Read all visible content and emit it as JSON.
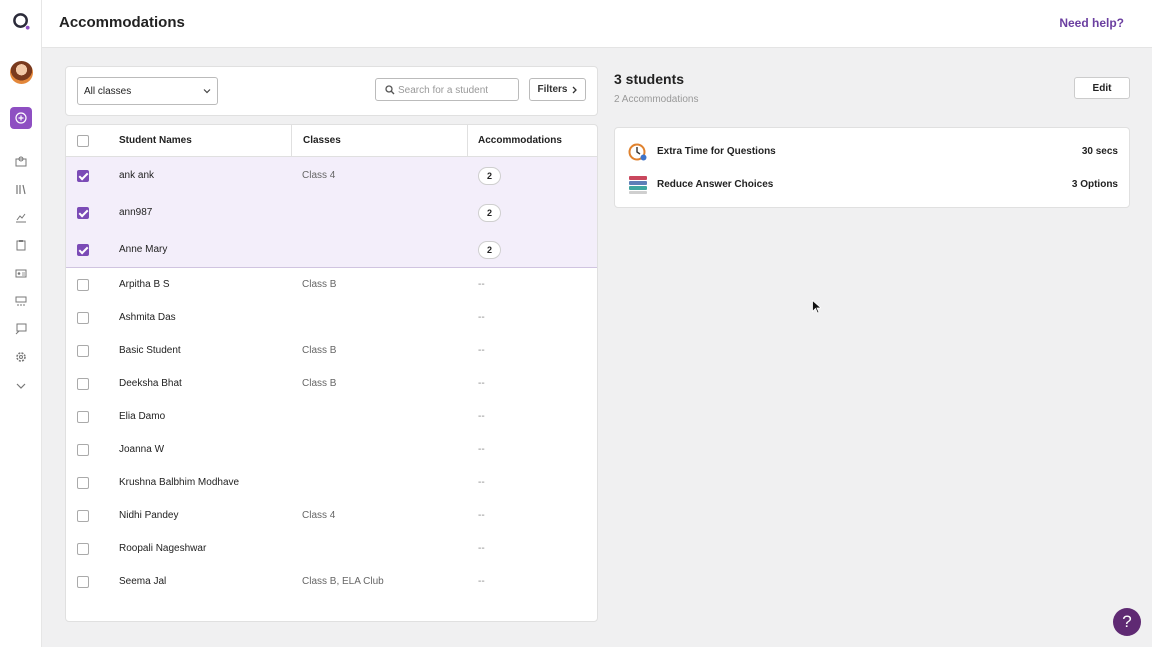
{
  "header": {
    "title": "Accommodations",
    "help_link": "Need help?"
  },
  "sidebar": {
    "icons": [
      "logo-icon",
      "avatar",
      "plus-icon",
      "users-icon",
      "library-icon",
      "reports-icon",
      "clipboard-icon",
      "id-card-icon",
      "classroom-icon",
      "chat-icon",
      "settings-icon",
      "chevron-down-icon"
    ]
  },
  "filters": {
    "class_select": "All classes",
    "search_placeholder": "Search for a student",
    "filters_button": "Filters"
  },
  "table": {
    "columns": [
      "Student Names",
      "Classes",
      "Accommodations"
    ],
    "rows": [
      {
        "name": "ank ank",
        "class": "Class 4",
        "accommodations": "2",
        "selected": true
      },
      {
        "name": "ann987",
        "class": "",
        "accommodations": "2",
        "selected": true
      },
      {
        "name": "Anne Mary",
        "class": "",
        "accommodations": "2",
        "selected": true
      },
      {
        "name": "Arpitha B S",
        "class": "Class B",
        "accommodations": "--",
        "selected": false
      },
      {
        "name": "Ashmita Das",
        "class": "",
        "accommodations": "--",
        "selected": false
      },
      {
        "name": "Basic Student",
        "class": "Class B",
        "accommodations": "--",
        "selected": false
      },
      {
        "name": "Deeksha Bhat",
        "class": "Class B",
        "accommodations": "--",
        "selected": false
      },
      {
        "name": "Elia Damo",
        "class": "",
        "accommodations": "--",
        "selected": false
      },
      {
        "name": "Joanna W",
        "class": "",
        "accommodations": "--",
        "selected": false
      },
      {
        "name": "Krushna Balbhim Modhave",
        "class": "",
        "accommodations": "--",
        "selected": false
      },
      {
        "name": "Nidhi Pandey",
        "class": "Class 4",
        "accommodations": "--",
        "selected": false
      },
      {
        "name": "Roopali Nageshwar",
        "class": "",
        "accommodations": "--",
        "selected": false
      },
      {
        "name": "Seema Jal",
        "class": "Class B, ELA Club",
        "accommodations": "--",
        "selected": false
      }
    ]
  },
  "summary": {
    "title": "3 students",
    "subtitle": "2 Accommodations",
    "edit_button": "Edit",
    "items": [
      {
        "icon": "timer-icon",
        "label": "Extra Time for Questions",
        "value": "30 secs"
      },
      {
        "icon": "stack-icon",
        "label": "Reduce Answer Choices",
        "value": "3 Options"
      }
    ]
  },
  "help_fab": "?",
  "colors": {
    "accent": "#7b4bb6",
    "link": "#6b3fa0",
    "fab": "#5f2a73",
    "selected_row": "#f3eefa"
  }
}
